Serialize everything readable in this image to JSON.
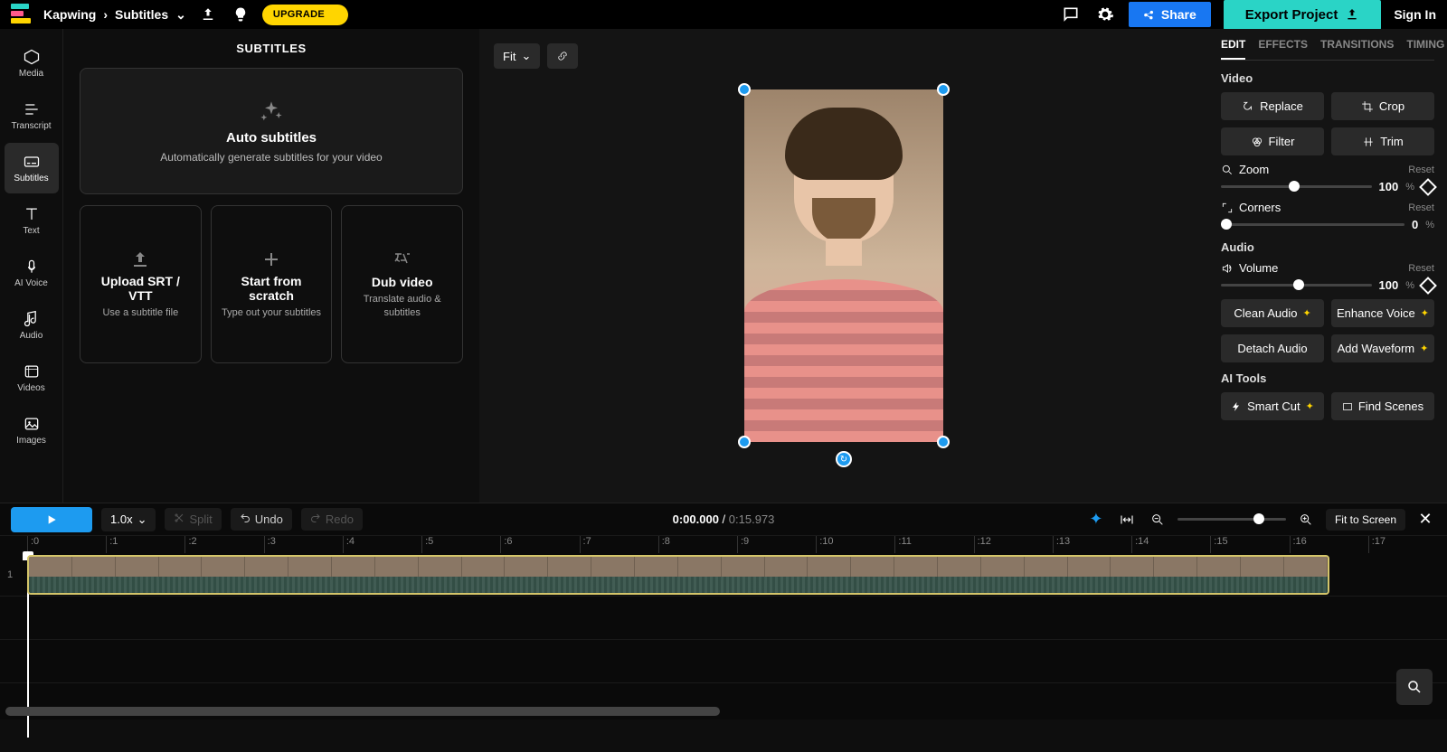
{
  "header": {
    "app": "Kapwing",
    "page": "Subtitles",
    "upgrade": "UPGRADE",
    "share": "Share",
    "export": "Export Project",
    "signin": "Sign In"
  },
  "rail": {
    "media": "Media",
    "transcript": "Transcript",
    "subtitles": "Subtitles",
    "text": "Text",
    "aivoice": "AI Voice",
    "audio": "Audio",
    "videos": "Videos",
    "images": "Images"
  },
  "panel": {
    "title": "SUBTITLES",
    "auto": {
      "title": "Auto subtitles",
      "sub": "Automatically generate subtitles for your video"
    },
    "upload": {
      "title": "Upload SRT / VTT",
      "sub": "Use a subtitle file"
    },
    "scratch": {
      "title": "Start from scratch",
      "sub": "Type out your subtitles"
    },
    "dub": {
      "title": "Dub video",
      "sub": "Translate audio & subtitles"
    }
  },
  "canvas": {
    "fit": "Fit"
  },
  "right": {
    "tabs": {
      "edit": "EDIT",
      "effects": "EFFECTS",
      "transitions": "TRANSITIONS",
      "timing": "TIMING"
    },
    "video": "Video",
    "replace": "Replace",
    "crop": "Crop",
    "filter": "Filter",
    "trim": "Trim",
    "zoom": "Zoom",
    "reset": "Reset",
    "zoom_val": "100",
    "pct": "%",
    "corners": "Corners",
    "corners_val": "0",
    "audio": "Audio",
    "volume": "Volume",
    "vol_val": "100",
    "clean": "Clean Audio",
    "enhance": "Enhance Voice",
    "detach": "Detach Audio",
    "addwave": "Add Waveform",
    "aitools": "AI Tools",
    "smartcut": "Smart Cut",
    "findscenes": "Find Scenes"
  },
  "timeline": {
    "speed": "1.0x",
    "split": "Split",
    "undo": "Undo",
    "redo": "Redo",
    "current": "0:00.000",
    "duration": "0:15.973",
    "fitscreen": "Fit to Screen",
    "ticks": [
      ":0",
      ":1",
      ":2",
      ":3",
      ":4",
      ":5",
      ":6",
      ":7",
      ":8",
      ":9",
      ":10",
      ":11",
      ":12",
      ":13",
      ":14",
      ":15",
      ":16",
      ":17"
    ],
    "track_num": "1"
  }
}
